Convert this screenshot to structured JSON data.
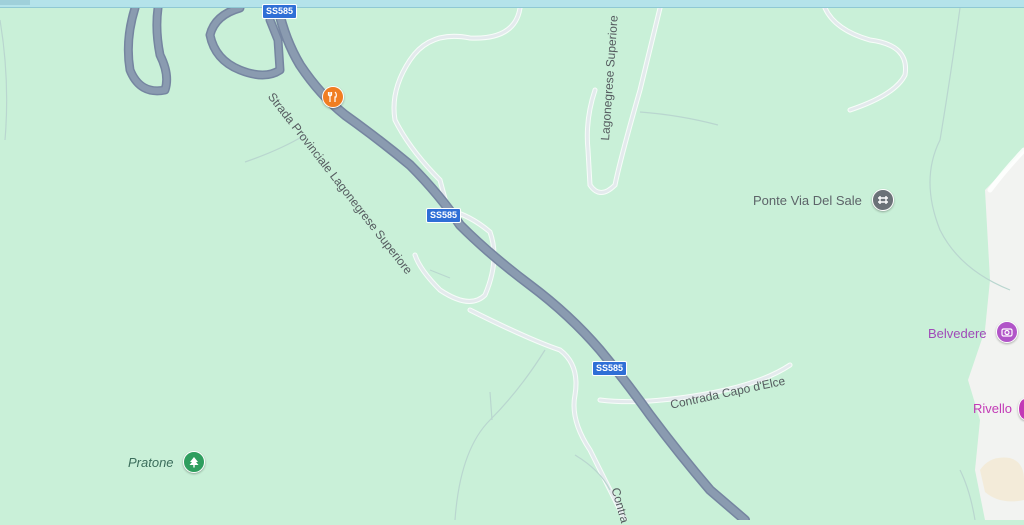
{
  "map": {
    "colors": {
      "land": "#c9f0d8",
      "highway": "#8a9bb0",
      "minor_road": "#e6ecee",
      "town": "#f2f3f1"
    },
    "shields": [
      {
        "label": "SS585"
      },
      {
        "label": "SS585"
      },
      {
        "label": "SS585"
      }
    ],
    "roads": [
      {
        "label": "Strada Provinciale Lagonegrese Superiore"
      },
      {
        "label": "Lagonegrese Superiore"
      },
      {
        "label": "Contrada Capo d'Elce"
      },
      {
        "label": "Contra"
      }
    ],
    "pois": [
      {
        "label": "Ponte Via Del Sale",
        "icon": "bridge-icon",
        "color": "#6b7278"
      },
      {
        "label": "Belvedere",
        "icon": "camera-icon",
        "color": "#b154c8"
      },
      {
        "label": "Rivello",
        "icon": "town-pin-icon",
        "color": "#c23ab6"
      },
      {
        "label": "Pratone",
        "icon": "tree-icon",
        "color": "#2e9e5e"
      },
      {
        "label": "",
        "icon": "restaurant-icon",
        "color": "#f07d22"
      }
    ]
  }
}
